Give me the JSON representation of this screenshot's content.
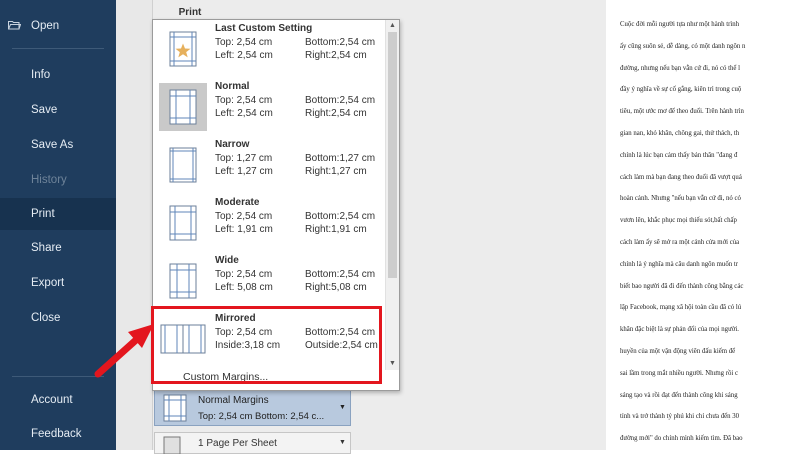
{
  "nav": {
    "items": [
      {
        "label": "Open",
        "state": "normal"
      },
      {
        "label": "Info",
        "state": "normal"
      },
      {
        "label": "Save",
        "state": "normal"
      },
      {
        "label": "Save As",
        "state": "normal"
      },
      {
        "label": "History",
        "state": "dim"
      },
      {
        "label": "Print",
        "state": "active"
      },
      {
        "label": "Share",
        "state": "normal"
      },
      {
        "label": "Export",
        "state": "normal"
      },
      {
        "label": "Close",
        "state": "normal"
      },
      {
        "label": "Account",
        "state": "normal"
      },
      {
        "label": "Feedback",
        "state": "normal"
      }
    ]
  },
  "print_tab": "Print",
  "margins_menu": {
    "options": [
      {
        "title": "Last Custom Setting",
        "l1": "Top:  2,54 cm",
        "r1": "Bottom:2,54 cm",
        "l2": "Left:  2,54 cm",
        "r2": "Right:2,54 cm",
        "icon": "last-custom-icon",
        "selected": false
      },
      {
        "title": "Normal",
        "l1": "Top:  2,54 cm",
        "r1": "Bottom:2,54 cm",
        "l2": "Left:  2,54 cm",
        "r2": "Right:2,54 cm",
        "icon": "normal-margins-icon",
        "selected": true
      },
      {
        "title": "Narrow",
        "l1": "Top:  1,27 cm",
        "r1": "Bottom:1,27 cm",
        "l2": "Left:  1,27 cm",
        "r2": "Right:1,27 cm",
        "icon": "narrow-margins-icon",
        "selected": false
      },
      {
        "title": "Moderate",
        "l1": "Top:  2,54 cm",
        "r1": "Bottom:2,54 cm",
        "l2": "Left:  1,91 cm",
        "r2": "Right:1,91 cm",
        "icon": "moderate-margins-icon",
        "selected": false
      },
      {
        "title": "Wide",
        "l1": "Top:  2,54 cm",
        "r1": "Bottom:2,54 cm",
        "l2": "Left:  5,08 cm",
        "r2": "Right:5,08 cm",
        "icon": "wide-margins-icon",
        "selected": false
      },
      {
        "title": "Mirrored",
        "l1": "Top:  2,54 cm",
        "r1": "Bottom:2,54 cm",
        "l2": "Inside:3,18 cm",
        "r2": "Outside:2,54 cm",
        "icon": "mirrored-margins-icon",
        "selected": false
      }
    ],
    "custom_label": "Custom Margins..."
  },
  "margins_selector": {
    "title": "Normal Margins",
    "detail": "Top: 2,54 cm Bottom: 2,54 c..."
  },
  "pages_selector": {
    "label": "1 Page Per Sheet"
  },
  "preview": {
    "lines": [
      "Cuộc đời mỗi người tựa như một hành trình",
      "ấy cũng suôn sẻ, dễ dàng, có một danh ngôn n",
      "đường, nhưng nếu bạn vẫn cứ đi, nó có thể l",
      "đầy ý nghĩa về sự cố gắng, kiên trì trong cuộ",
      "tiêu, một ước mơ để theo đuổi. Trên hành trìn",
      "gian nan, khó khăn, chông gai, thử thách, th",
      "chính là lúc bạn cảm thấy bản thân \"đang đ",
      "cách làm mà bạn đang theo đuổi đã vượt quá",
      "hoàn cảnh. Nhưng \"nếu bạn vẫn cứ đi, nó có",
      "vươn lên, khắc phục mọi thiếu sót,bất chấp",
      "cách làm ấy sẽ mở ra một cánh cửa mới của",
      "chính là ý nghĩa mà câu danh ngôn muốn tr",
      "biết bao người đã đi đến thành công bằng các",
      "lập Facebook, mạng xã hội toàn cầu đã có lú",
      "khăn đặc biệt là sự phản đối của mọi người.",
      "huyền của một vận động viên đấu kiếm để",
      "sai lầm trong mắt nhiều người. Nhưng rồi c",
      "sáng tạo và rồi đạt đến thành công khi sáng",
      "tỉnh và trở thành tỷ phú khi chỉ chưa đến 30",
      "đường mới\" do chính mình kiếm tìm. Đã bao"
    ]
  },
  "colors": {
    "nav_bg": "#1f3d5e",
    "highlight": "#e3161e",
    "selected_bg": "#b8c9de"
  }
}
